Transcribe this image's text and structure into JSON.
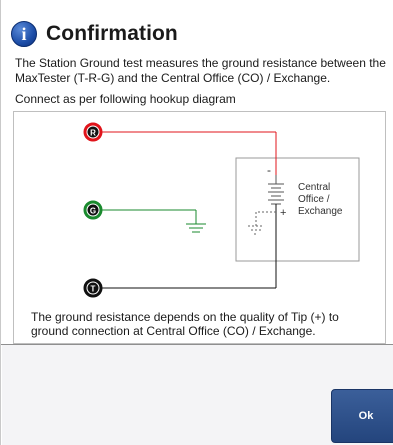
{
  "dialog": {
    "title": "Confirmation",
    "message": "The Station Ground test measures the ground resistance between the MaxTester (T-R-G) and the Central Office (CO) / Exchange.",
    "instruction": "Connect as per following hookup diagram",
    "note": "The ground resistance depends on the quality of Tip (+) to ground connection at Central Office (CO) / Exchange.",
    "ok_label": "Ok"
  },
  "diagram": {
    "terminals": [
      {
        "letter": "R",
        "color": "#e0141b"
      },
      {
        "letter": "G",
        "color": "#1a8a2e"
      },
      {
        "letter": "T",
        "color": "#111111"
      }
    ],
    "co_label_line1": "Central",
    "co_label_line2": "Office /",
    "co_label_line3": "Exchange",
    "minus_sign": "-",
    "plus_sign": "+"
  }
}
